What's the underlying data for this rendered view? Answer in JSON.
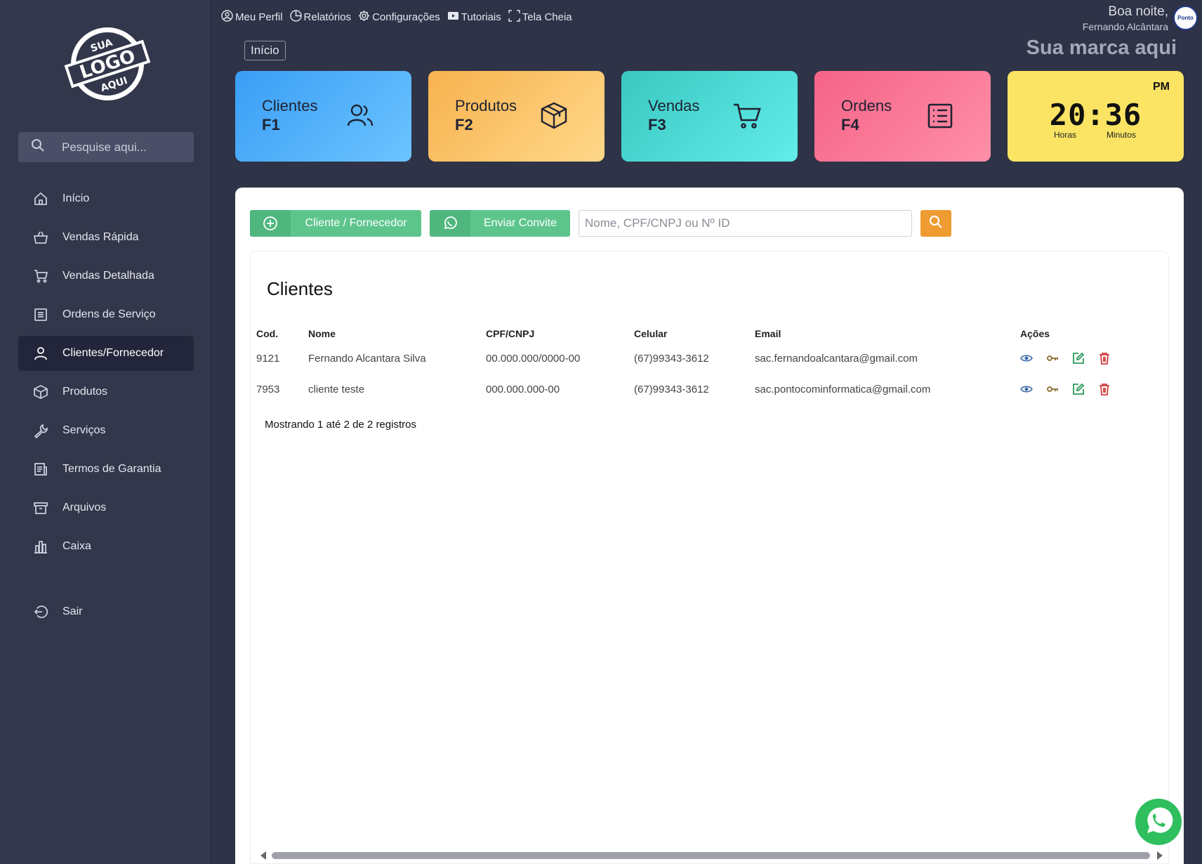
{
  "sidebar": {
    "logo_text": [
      "SUA",
      "LOGO",
      "AQUI"
    ],
    "search_placeholder": "Pesquise aqui...",
    "items": [
      {
        "label": "Início",
        "icon": "home-icon"
      },
      {
        "label": "Vendas Rápida",
        "icon": "basket-icon"
      },
      {
        "label": "Vendas Detalhada",
        "icon": "cart-icon"
      },
      {
        "label": "Ordens de Serviço",
        "icon": "list-icon"
      },
      {
        "label": "Clientes/Fornecedor",
        "icon": "user-icon",
        "active": true
      },
      {
        "label": "Produtos",
        "icon": "box-icon"
      },
      {
        "label": "Serviços",
        "icon": "wrench-icon"
      },
      {
        "label": "Termos de Garantia",
        "icon": "document-icon"
      },
      {
        "label": "Arquivos",
        "icon": "archive-icon"
      },
      {
        "label": "Caixa",
        "icon": "bar-chart-icon"
      },
      {
        "label": "Sair",
        "icon": "logout-icon"
      }
    ]
  },
  "topmenu": [
    "Meu Perfil",
    "Relatórios",
    "Configurações",
    "Tutoriais",
    "Tela Cheia"
  ],
  "greeting": {
    "line1": "Boa noite,",
    "line2": "Fernando Alcântara",
    "avatar_text": "Ponto"
  },
  "brand": "Sua marca aqui",
  "breadcrumb": "Início",
  "cards": [
    {
      "label": "Clientes",
      "key": "F1",
      "color": "#3a9ef5"
    },
    {
      "label": "Produtos",
      "key": "F2",
      "color": "#f7b24e"
    },
    {
      "label": "Vendas",
      "key": "F3",
      "color": "#3ac8c0"
    },
    {
      "label": "Ordens",
      "key": "F4",
      "color": "#f56387"
    }
  ],
  "clock": {
    "period": "PM",
    "time": "20:36",
    "hours_label": "Horas",
    "minutes_label": "Minutos"
  },
  "actions": {
    "add_client": "Cliente / Fornecedor",
    "invite": "Enviar Convite",
    "search_placeholder": "Nome, CPF/CNPJ ou Nº ID"
  },
  "table": {
    "title": "Clientes",
    "columns": [
      "Cod.",
      "Nome",
      "CPF/CNPJ",
      "Celular",
      "Email",
      "Ações"
    ],
    "rows": [
      [
        "9121",
        "Fernando Alcantara Silva",
        "00.000.000/0000-00",
        "(67)99343-3612",
        "sac.fernandoalcantara@gmail.com"
      ],
      [
        "7953",
        "cliente teste",
        "000.000.000-00",
        "(67)99343-3612",
        "sac.pontocominformatica@gmail.com"
      ]
    ],
    "info": "Mostrando 1 até 2 de 2 registros"
  }
}
